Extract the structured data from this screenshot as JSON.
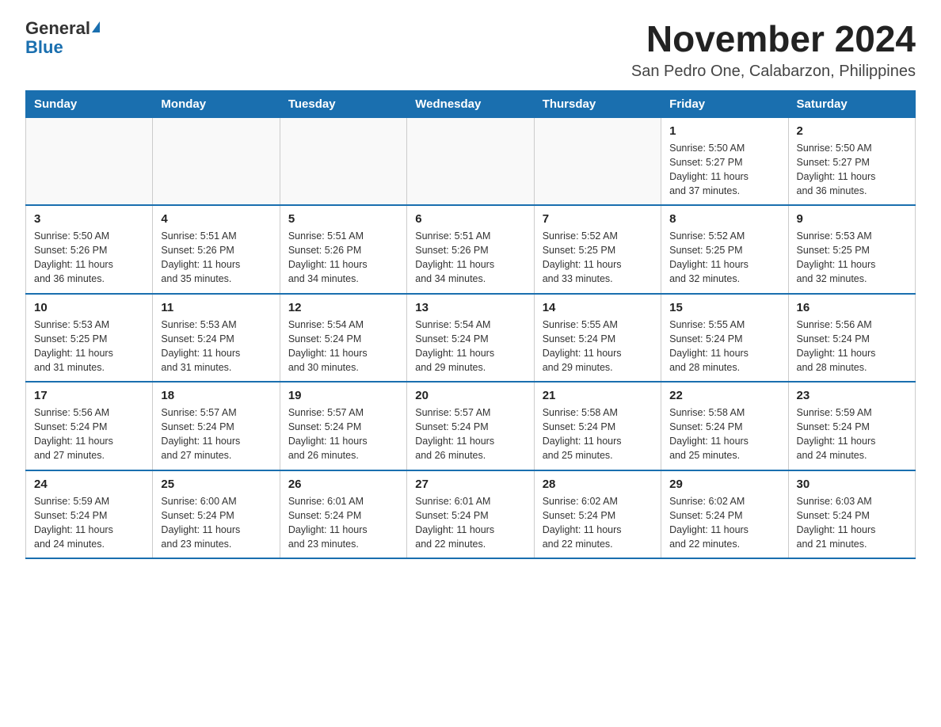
{
  "header": {
    "logo_general": "General",
    "logo_blue": "Blue",
    "month_title": "November 2024",
    "location": "San Pedro One, Calabarzon, Philippines"
  },
  "weekdays": [
    "Sunday",
    "Monday",
    "Tuesday",
    "Wednesday",
    "Thursday",
    "Friday",
    "Saturday"
  ],
  "weeks": [
    [
      {
        "day": "",
        "info": ""
      },
      {
        "day": "",
        "info": ""
      },
      {
        "day": "",
        "info": ""
      },
      {
        "day": "",
        "info": ""
      },
      {
        "day": "",
        "info": ""
      },
      {
        "day": "1",
        "info": "Sunrise: 5:50 AM\nSunset: 5:27 PM\nDaylight: 11 hours\nand 37 minutes."
      },
      {
        "day": "2",
        "info": "Sunrise: 5:50 AM\nSunset: 5:27 PM\nDaylight: 11 hours\nand 36 minutes."
      }
    ],
    [
      {
        "day": "3",
        "info": "Sunrise: 5:50 AM\nSunset: 5:26 PM\nDaylight: 11 hours\nand 36 minutes."
      },
      {
        "day": "4",
        "info": "Sunrise: 5:51 AM\nSunset: 5:26 PM\nDaylight: 11 hours\nand 35 minutes."
      },
      {
        "day": "5",
        "info": "Sunrise: 5:51 AM\nSunset: 5:26 PM\nDaylight: 11 hours\nand 34 minutes."
      },
      {
        "day": "6",
        "info": "Sunrise: 5:51 AM\nSunset: 5:26 PM\nDaylight: 11 hours\nand 34 minutes."
      },
      {
        "day": "7",
        "info": "Sunrise: 5:52 AM\nSunset: 5:25 PM\nDaylight: 11 hours\nand 33 minutes."
      },
      {
        "day": "8",
        "info": "Sunrise: 5:52 AM\nSunset: 5:25 PM\nDaylight: 11 hours\nand 32 minutes."
      },
      {
        "day": "9",
        "info": "Sunrise: 5:53 AM\nSunset: 5:25 PM\nDaylight: 11 hours\nand 32 minutes."
      }
    ],
    [
      {
        "day": "10",
        "info": "Sunrise: 5:53 AM\nSunset: 5:25 PM\nDaylight: 11 hours\nand 31 minutes."
      },
      {
        "day": "11",
        "info": "Sunrise: 5:53 AM\nSunset: 5:24 PM\nDaylight: 11 hours\nand 31 minutes."
      },
      {
        "day": "12",
        "info": "Sunrise: 5:54 AM\nSunset: 5:24 PM\nDaylight: 11 hours\nand 30 minutes."
      },
      {
        "day": "13",
        "info": "Sunrise: 5:54 AM\nSunset: 5:24 PM\nDaylight: 11 hours\nand 29 minutes."
      },
      {
        "day": "14",
        "info": "Sunrise: 5:55 AM\nSunset: 5:24 PM\nDaylight: 11 hours\nand 29 minutes."
      },
      {
        "day": "15",
        "info": "Sunrise: 5:55 AM\nSunset: 5:24 PM\nDaylight: 11 hours\nand 28 minutes."
      },
      {
        "day": "16",
        "info": "Sunrise: 5:56 AM\nSunset: 5:24 PM\nDaylight: 11 hours\nand 28 minutes."
      }
    ],
    [
      {
        "day": "17",
        "info": "Sunrise: 5:56 AM\nSunset: 5:24 PM\nDaylight: 11 hours\nand 27 minutes."
      },
      {
        "day": "18",
        "info": "Sunrise: 5:57 AM\nSunset: 5:24 PM\nDaylight: 11 hours\nand 27 minutes."
      },
      {
        "day": "19",
        "info": "Sunrise: 5:57 AM\nSunset: 5:24 PM\nDaylight: 11 hours\nand 26 minutes."
      },
      {
        "day": "20",
        "info": "Sunrise: 5:57 AM\nSunset: 5:24 PM\nDaylight: 11 hours\nand 26 minutes."
      },
      {
        "day": "21",
        "info": "Sunrise: 5:58 AM\nSunset: 5:24 PM\nDaylight: 11 hours\nand 25 minutes."
      },
      {
        "day": "22",
        "info": "Sunrise: 5:58 AM\nSunset: 5:24 PM\nDaylight: 11 hours\nand 25 minutes."
      },
      {
        "day": "23",
        "info": "Sunrise: 5:59 AM\nSunset: 5:24 PM\nDaylight: 11 hours\nand 24 minutes."
      }
    ],
    [
      {
        "day": "24",
        "info": "Sunrise: 5:59 AM\nSunset: 5:24 PM\nDaylight: 11 hours\nand 24 minutes."
      },
      {
        "day": "25",
        "info": "Sunrise: 6:00 AM\nSunset: 5:24 PM\nDaylight: 11 hours\nand 23 minutes."
      },
      {
        "day": "26",
        "info": "Sunrise: 6:01 AM\nSunset: 5:24 PM\nDaylight: 11 hours\nand 23 minutes."
      },
      {
        "day": "27",
        "info": "Sunrise: 6:01 AM\nSunset: 5:24 PM\nDaylight: 11 hours\nand 22 minutes."
      },
      {
        "day": "28",
        "info": "Sunrise: 6:02 AM\nSunset: 5:24 PM\nDaylight: 11 hours\nand 22 minutes."
      },
      {
        "day": "29",
        "info": "Sunrise: 6:02 AM\nSunset: 5:24 PM\nDaylight: 11 hours\nand 22 minutes."
      },
      {
        "day": "30",
        "info": "Sunrise: 6:03 AM\nSunset: 5:24 PM\nDaylight: 11 hours\nand 21 minutes."
      }
    ]
  ]
}
